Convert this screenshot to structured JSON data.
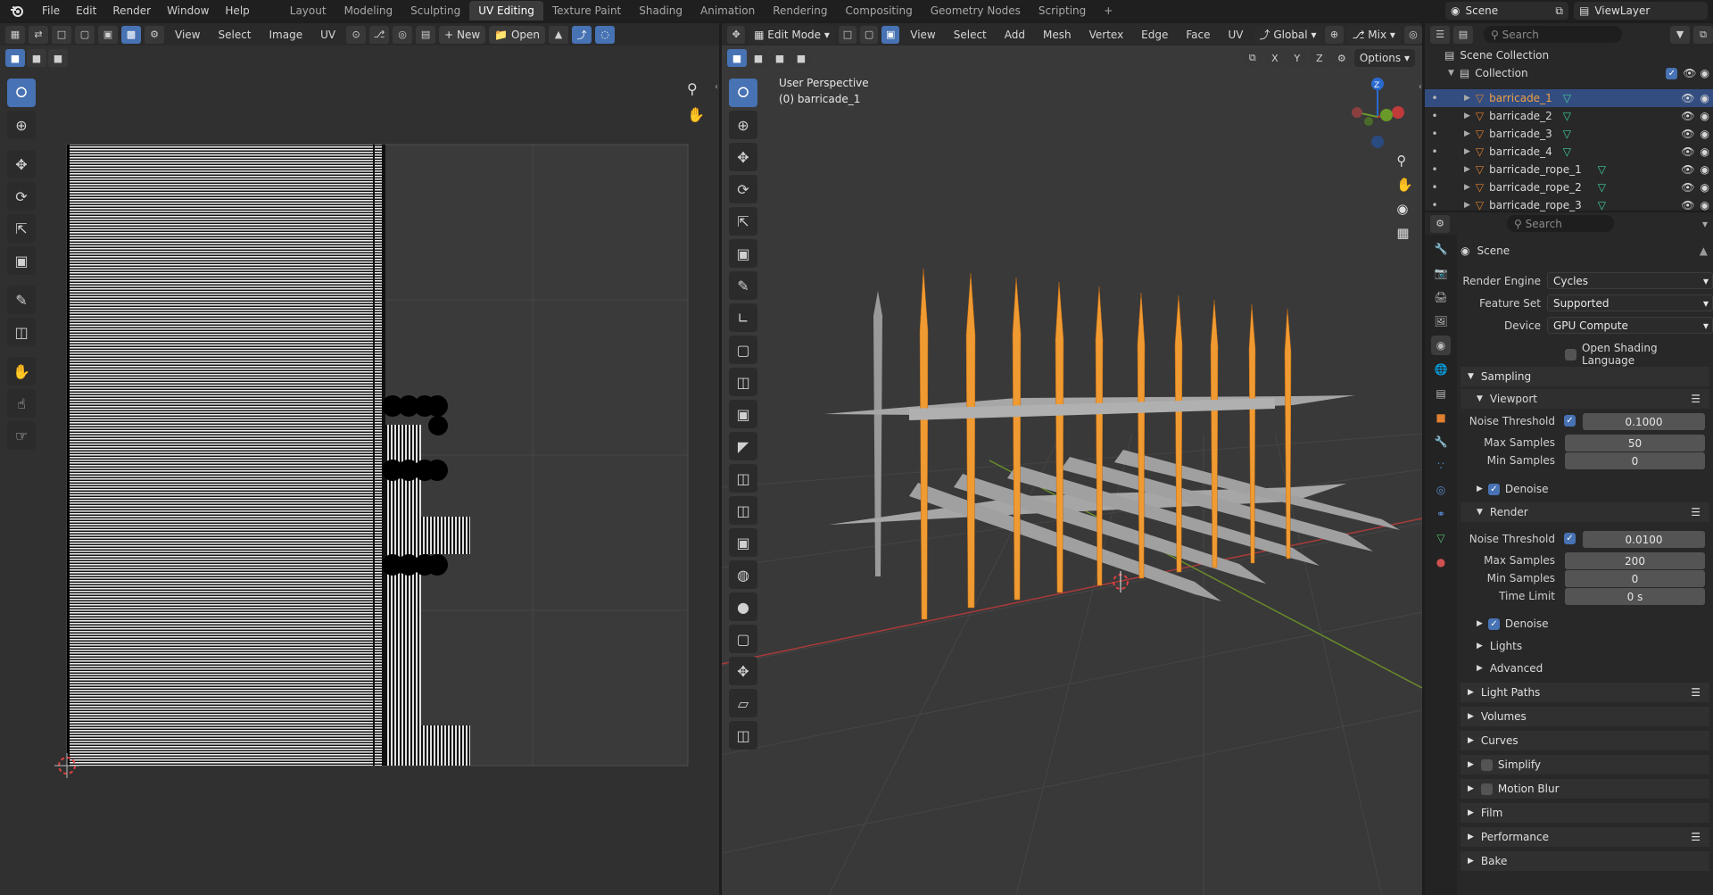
{
  "menus": [
    "File",
    "Edit",
    "Render",
    "Window",
    "Help"
  ],
  "workspaces": [
    "Layout",
    "Modeling",
    "Sculpting",
    "UV Editing",
    "Texture Paint",
    "Shading",
    "Animation",
    "Rendering",
    "Compositing",
    "Geometry Nodes",
    "Scripting"
  ],
  "active_workspace": "UV Editing",
  "add_workspace": "+",
  "scene": {
    "name": "Scene",
    "view_layer": "ViewLayer"
  },
  "uv_editor": {
    "menus": [
      "View",
      "Select",
      "Image",
      "UV"
    ],
    "new_label": "New",
    "open_label": "Open"
  },
  "viewport": {
    "mode": "Edit Mode",
    "menus": [
      "View",
      "Select",
      "Add",
      "Mesh",
      "Vertex",
      "Edge",
      "Face",
      "UV"
    ],
    "orientation": "Global",
    "shading": "Mix",
    "options": "Options",
    "axes": [
      "X",
      "Y",
      "Z"
    ],
    "overlay_title": "User Perspective",
    "overlay_object": "(0) barricade_1"
  },
  "outliner": {
    "search_placeholder": "Search",
    "scene_collection": "Scene Collection",
    "collection": "Collection",
    "items": [
      "barricade_1",
      "barricade_2",
      "barricade_3",
      "barricade_4",
      "barricade_rope_1",
      "barricade_rope_2",
      "barricade_rope_3"
    ],
    "selected": "barricade_1"
  },
  "properties": {
    "search_placeholder": "Search",
    "context": "Scene",
    "render_engine_label": "Render Engine",
    "render_engine": "Cycles",
    "feature_set_label": "Feature Set",
    "feature_set": "Supported",
    "device_label": "Device",
    "device": "GPU Compute",
    "osl_label": "Open Shading Language",
    "sampling": "Sampling",
    "viewport_sub": "Viewport",
    "noise_threshold_label": "Noise Threshold",
    "viewport_noise": "0.1000",
    "max_samples_label": "Max Samples",
    "viewport_max": "50",
    "min_samples_label": "Min Samples",
    "viewport_min": "0",
    "denoise_label": "Denoise",
    "render_sub": "Render",
    "render_noise": "0.0100",
    "render_max": "200",
    "render_min": "0",
    "time_limit_label": "Time Limit",
    "time_limit": "0 s",
    "lights": "Lights",
    "advanced": "Advanced",
    "panels": [
      "Light Paths",
      "Volumes",
      "Curves",
      "Simplify",
      "Motion Blur",
      "Film",
      "Performance",
      "Bake"
    ]
  }
}
